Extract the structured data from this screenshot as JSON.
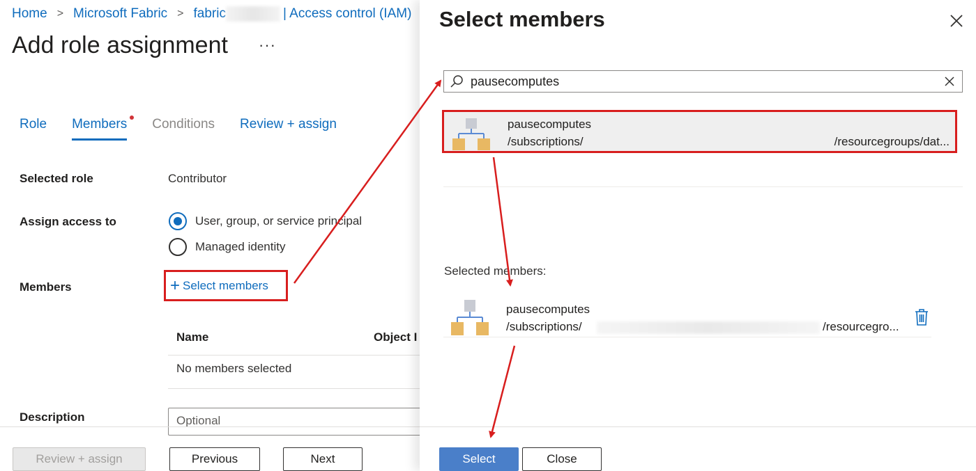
{
  "breadcrumb": {
    "items": [
      "Home",
      "Microsoft Fabric",
      "fabric"
    ],
    "last": "| Access control (IAM)"
  },
  "page": {
    "title": "Add role assignment",
    "more": "···"
  },
  "tabs": [
    {
      "label": "Role"
    },
    {
      "label": "Members"
    },
    {
      "label": "Conditions"
    },
    {
      "label": "Review + assign"
    }
  ],
  "form": {
    "selected_role_label": "Selected role",
    "selected_role_value": "Contributor",
    "assign_access_label": "Assign access to",
    "assign_options": [
      "User, group, or service principal",
      "Managed identity"
    ],
    "assign_selected": "User, group, or service principal",
    "members_label": "Members",
    "select_members": "Select members",
    "table_headers": [
      "Name",
      "Object I"
    ],
    "empty_row": "No members selected",
    "description_label": "Description",
    "description_placeholder": "Optional"
  },
  "footer": {
    "review_assign": "Review + assign",
    "previous": "Previous",
    "next": "Next"
  },
  "panel": {
    "title": "Select members",
    "search_value": "pausecomputes",
    "result": {
      "name": "pausecomputes",
      "path_start": "/subscriptions/",
      "path_end": "/resourcegroups/dat..."
    },
    "selected_label": "Selected members:",
    "selected_item": {
      "name": "pausecomputes",
      "path_start": "/subscriptions/",
      "path_end": "/resourcegro..."
    },
    "select_button": "Select",
    "close_button": "Close"
  },
  "colors": {
    "accent": "#0f6cbd",
    "highlight": "#d81e1e",
    "primary_button": "#4a7fc9"
  },
  "icons": {
    "breadcrumb_separator": "chevron-right-icon",
    "search": "search-icon",
    "clear": "dismiss-icon",
    "close": "close-icon",
    "resource": "resource-group-icon",
    "delete": "trash-icon"
  }
}
